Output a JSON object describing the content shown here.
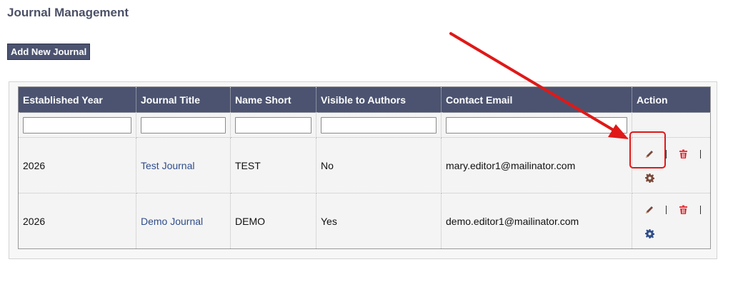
{
  "page": {
    "title": "Journal Management",
    "add_button_label": "Add New Journal"
  },
  "table": {
    "headers": [
      "Established Year",
      "Journal Title",
      "Name Short",
      "Visible to Authors",
      "Contact Email",
      "Action"
    ],
    "rows": [
      {
        "year": "2026",
        "title": "Test Journal",
        "short": "TEST",
        "visible": "No",
        "email": "mary.editor1@mailinator.com"
      },
      {
        "year": "2026",
        "title": "Demo Journal",
        "short": "DEMO",
        "visible": "Yes",
        "email": "demo.editor1@mailinator.com"
      }
    ],
    "filters": [
      "",
      "",
      "",
      "",
      ""
    ]
  },
  "icons": {
    "edit": "pencil-icon",
    "delete": "trash-icon",
    "settings": "gear-icon"
  },
  "colors": {
    "header_bg": "#4b5370",
    "link": "#2f4d8a",
    "delete": "#e0393e",
    "edit": "#7a4a3a",
    "annotation": "#e01818"
  }
}
